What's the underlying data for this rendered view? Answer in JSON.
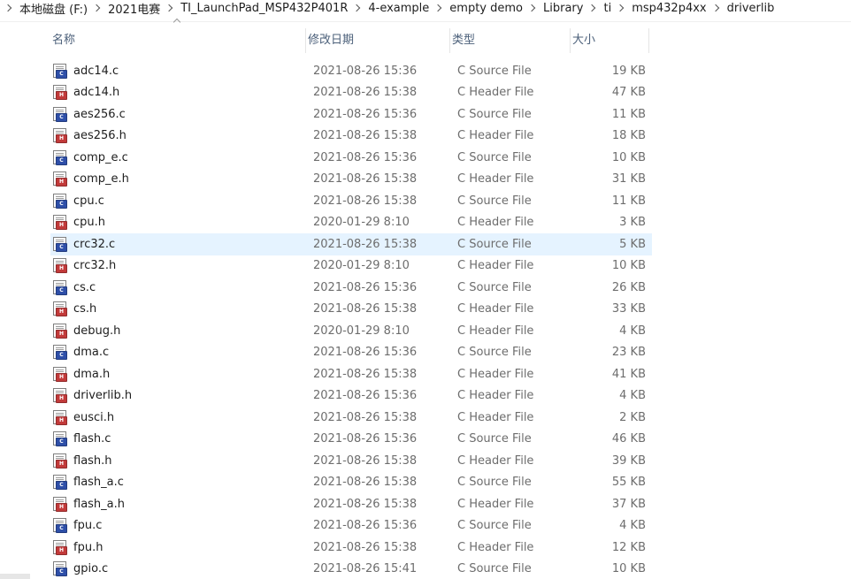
{
  "breadcrumb": [
    "本地磁盘 (F:)",
    "2021电赛",
    "TI_LaunchPad_MSP432P401R",
    "4-example",
    "empty demo",
    "Library",
    "ti",
    "msp432p4xx",
    "driverlib"
  ],
  "columns": {
    "name": "名称",
    "date": "修改日期",
    "type": "类型",
    "size": "大小"
  },
  "icons": {
    "c": {
      "name": "c-source-file-icon",
      "badge": "C",
      "color": "#2e4fa8"
    },
    "h": {
      "name": "c-header-file-icon",
      "badge": "H",
      "color": "#c23a3a"
    }
  },
  "files": [
    {
      "name": "adc14.c",
      "date": "2021-08-26 15:36",
      "type": "C Source File",
      "size": "19 KB",
      "kind": "c"
    },
    {
      "name": "adc14.h",
      "date": "2021-08-26 15:38",
      "type": "C Header File",
      "size": "47 KB",
      "kind": "h"
    },
    {
      "name": "aes256.c",
      "date": "2021-08-26 15:36",
      "type": "C Source File",
      "size": "11 KB",
      "kind": "c"
    },
    {
      "name": "aes256.h",
      "date": "2021-08-26 15:38",
      "type": "C Header File",
      "size": "18 KB",
      "kind": "h"
    },
    {
      "name": "comp_e.c",
      "date": "2021-08-26 15:36",
      "type": "C Source File",
      "size": "10 KB",
      "kind": "c"
    },
    {
      "name": "comp_e.h",
      "date": "2021-08-26 15:38",
      "type": "C Header File",
      "size": "31 KB",
      "kind": "h"
    },
    {
      "name": "cpu.c",
      "date": "2021-08-26 15:38",
      "type": "C Source File",
      "size": "11 KB",
      "kind": "c"
    },
    {
      "name": "cpu.h",
      "date": "2020-01-29 8:10",
      "type": "C Header File",
      "size": "3 KB",
      "kind": "h"
    },
    {
      "name": "crc32.c",
      "date": "2021-08-26 15:38",
      "type": "C Source File",
      "size": "5 KB",
      "kind": "c",
      "hover": true
    },
    {
      "name": "crc32.h",
      "date": "2020-01-29 8:10",
      "type": "C Header File",
      "size": "10 KB",
      "kind": "h"
    },
    {
      "name": "cs.c",
      "date": "2021-08-26 15:36",
      "type": "C Source File",
      "size": "26 KB",
      "kind": "c"
    },
    {
      "name": "cs.h",
      "date": "2021-08-26 15:38",
      "type": "C Header File",
      "size": "33 KB",
      "kind": "h"
    },
    {
      "name": "debug.h",
      "date": "2020-01-29 8:10",
      "type": "C Header File",
      "size": "4 KB",
      "kind": "h"
    },
    {
      "name": "dma.c",
      "date": "2021-08-26 15:36",
      "type": "C Source File",
      "size": "23 KB",
      "kind": "c"
    },
    {
      "name": "dma.h",
      "date": "2021-08-26 15:38",
      "type": "C Header File",
      "size": "41 KB",
      "kind": "h"
    },
    {
      "name": "driverlib.h",
      "date": "2021-08-26 15:36",
      "type": "C Header File",
      "size": "4 KB",
      "kind": "h"
    },
    {
      "name": "eusci.h",
      "date": "2021-08-26 15:38",
      "type": "C Header File",
      "size": "2 KB",
      "kind": "h"
    },
    {
      "name": "flash.c",
      "date": "2021-08-26 15:36",
      "type": "C Source File",
      "size": "46 KB",
      "kind": "c"
    },
    {
      "name": "flash.h",
      "date": "2021-08-26 15:38",
      "type": "C Header File",
      "size": "39 KB",
      "kind": "h"
    },
    {
      "name": "flash_a.c",
      "date": "2021-08-26 15:38",
      "type": "C Source File",
      "size": "55 KB",
      "kind": "c"
    },
    {
      "name": "flash_a.h",
      "date": "2021-08-26 15:38",
      "type": "C Header File",
      "size": "37 KB",
      "kind": "h"
    },
    {
      "name": "fpu.c",
      "date": "2021-08-26 15:36",
      "type": "C Source File",
      "size": "4 KB",
      "kind": "c"
    },
    {
      "name": "fpu.h",
      "date": "2021-08-26 15:38",
      "type": "C Header File",
      "size": "12 KB",
      "kind": "h"
    },
    {
      "name": "gpio.c",
      "date": "2021-08-26 15:41",
      "type": "C Source File",
      "size": "10 KB",
      "kind": "c"
    }
  ]
}
